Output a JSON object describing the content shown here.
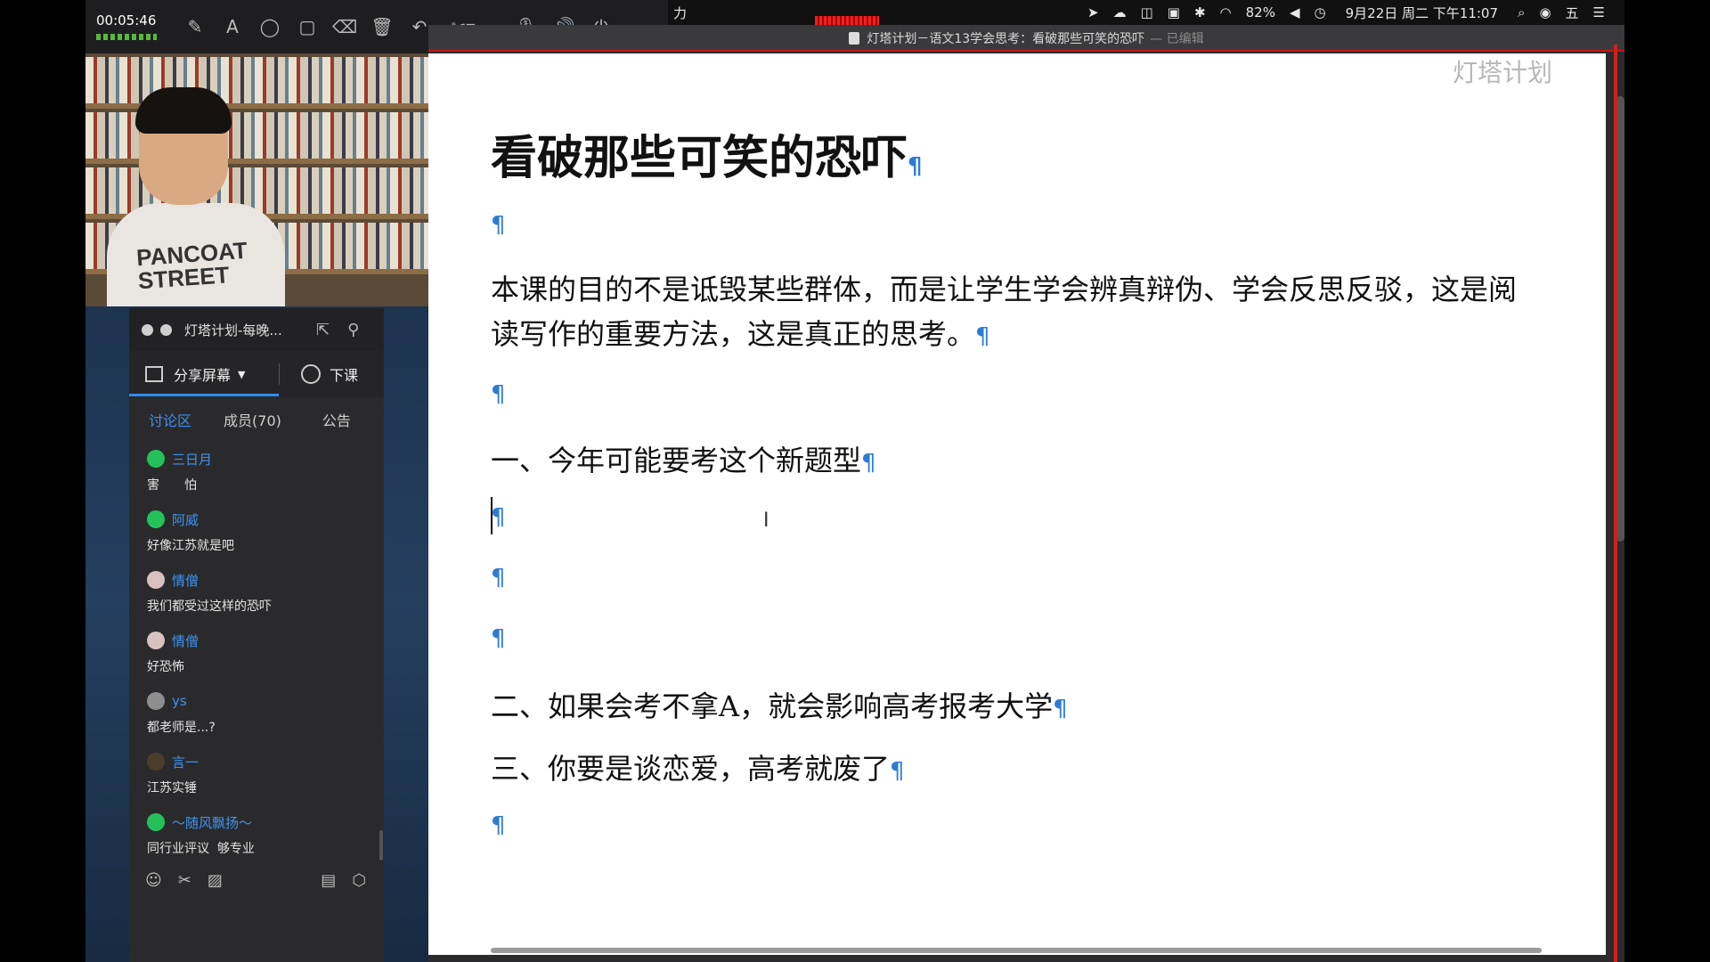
{
  "recorder": {
    "elapsed": "00:05:46",
    "tools": [
      "✎",
      "A",
      "◯",
      "▢",
      "⌫",
      "🗑",
      "↶",
      "✂▾",
      "🎙",
      "🔊",
      "⏻"
    ],
    "tool_names": [
      "pen-icon",
      "text-icon",
      "circle-icon",
      "rectangle-icon",
      "eraser-icon",
      "trash-icon",
      "undo-icon",
      "scissors-icon",
      "microphone-icon",
      "speaker-icon",
      "power-icon"
    ]
  },
  "menubar": {
    "app_fragment": "力",
    "battery": "82%",
    "clock": "9月22日 周二 下午11:07",
    "icons": [
      "location-arrow-icon",
      "notification-icon",
      "camera-icon",
      "screen-icon",
      "bluetooth-icon",
      "wifi-icon"
    ],
    "glyphs": [
      "➤",
      "☁",
      "◫",
      "▣",
      "✱",
      "◠"
    ]
  },
  "document": {
    "window_title": "灯塔计划－语文13学会思考：看破那些可笑的恐吓",
    "edited_status": "— 已编辑",
    "watermark": "灯塔计划",
    "pilcrow": "¶",
    "title": "看破那些可笑的恐吓",
    "paragraph": "本课的目的不是诋毁某些群体，而是让学生学会辨真辩伪、学会反思反驳，这是阅读写作的重要方法，这是真正的思考。",
    "heading1": "一、今年可能要考这个新题型",
    "heading2": "二、如果会考不拿A，就会影响高考报考大学",
    "heading3": "三、你要是谈恋爱，高考就废了"
  },
  "webcam": {
    "shirt_text": "PANCOAT\nSTREET"
  },
  "chat": {
    "group_name": "灯塔计划-每晚...",
    "share_screen": "分享屏幕",
    "end_class": "下课",
    "tabs": {
      "discussion": "讨论区",
      "members": "成员(70)",
      "notice": "公告"
    },
    "messages": [
      {
        "user": "三日月",
        "text": "害　　怕",
        "avatar": "wx"
      },
      {
        "user": "阿威",
        "text": "好像江苏就是吧",
        "avatar": "wx"
      },
      {
        "user": "情僧",
        "text": "我们都受过这样的恐吓",
        "avatar": "pink"
      },
      {
        "user": "情僧",
        "text": "好恐怖",
        "avatar": "pink"
      },
      {
        "user": "ys",
        "text": "都老师是...?",
        "avatar": "gray"
      },
      {
        "user": "言一",
        "text": "江苏实锤",
        "avatar": "dark"
      },
      {
        "user": "～随风飘扬～",
        "text": "同行业评议  够专业",
        "avatar": "wx"
      }
    ]
  }
}
